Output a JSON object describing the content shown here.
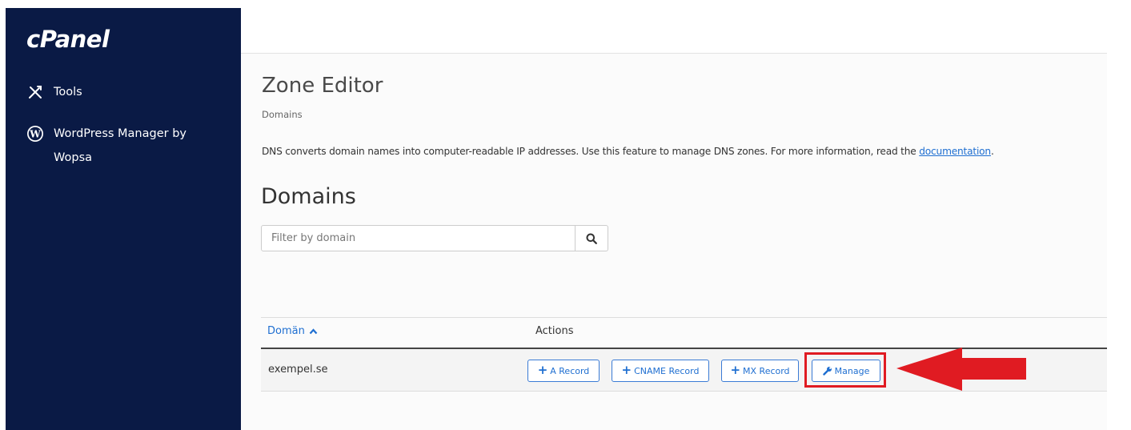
{
  "sidebar": {
    "logo": "cPanel",
    "items": [
      {
        "label": "Tools",
        "icon": "tools-icon"
      },
      {
        "label": "WordPress Manager by Wopsa",
        "icon": "wordpress-icon"
      }
    ]
  },
  "page": {
    "title": "Zone Editor",
    "breadcrumb": "Domains",
    "description": "DNS converts domain names into computer-readable IP addresses. Use this feature to manage DNS zones. For more information, read the ",
    "doc_link": "documentation",
    "description_end": ".",
    "section_title": "Domains"
  },
  "search": {
    "placeholder": "Filter by domain",
    "icon": "search-icon"
  },
  "table": {
    "columns": [
      "Domän",
      "Actions"
    ],
    "rows": [
      {
        "domain": "exempel.se",
        "actions": [
          "A Record",
          "CNAME Record",
          "MX Record",
          "Manage"
        ]
      }
    ]
  },
  "colors": {
    "sidebar_bg": "#0a1a45",
    "link": "#1f6fd1",
    "highlight": "#e01b22"
  }
}
